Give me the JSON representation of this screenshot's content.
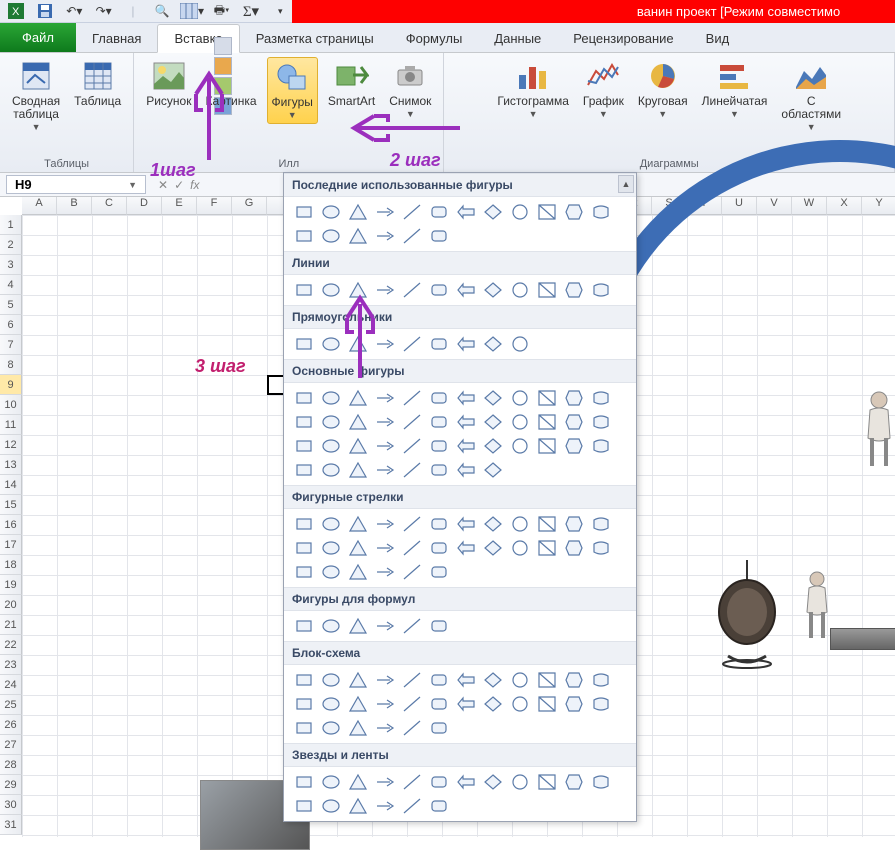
{
  "titlebar": {
    "title": "ванин проект  [Режим совместимо"
  },
  "qat": [
    {
      "name": "save-icon"
    },
    {
      "name": "undo-icon"
    },
    {
      "name": "redo-icon"
    },
    {
      "name": "preview-icon"
    },
    {
      "name": "pivot-icon"
    },
    {
      "name": "print-icon"
    },
    {
      "name": "sum-icon"
    }
  ],
  "tabs": {
    "file": "Файл",
    "home": "Главная",
    "insert": "Вставка",
    "layout": "Разметка страницы",
    "formulas": "Формулы",
    "data": "Данные",
    "review": "Рецензирование",
    "view": "Вид"
  },
  "ribbon": {
    "tables": {
      "group": "Таблицы",
      "pivot": "Сводная\nтаблица",
      "table": "Таблица"
    },
    "illustr": {
      "group": "Илл",
      "picture": "Рисунок",
      "clipart": "Картинка",
      "shapes": "Фигуры",
      "smartart": "SmartArt",
      "screenshot": "Снимок"
    },
    "charts": {
      "group": "Диаграммы",
      "column": "Гистограмма",
      "line": "График",
      "pie": "Круговая",
      "bar": "Линейчатая",
      "area": "С\nобластями"
    }
  },
  "namebox": "H9",
  "columns": [
    "A",
    "B",
    "C",
    "D",
    "E",
    "F",
    "G",
    "",
    "",
    "",
    "",
    "",
    "",
    "",
    "",
    "",
    "",
    "R",
    "S",
    "T",
    "U",
    "V",
    "W",
    "X",
    "Y"
  ],
  "rows": [
    "1",
    "2",
    "3",
    "4",
    "5",
    "6",
    "7",
    "8",
    "9",
    "10",
    "11",
    "12",
    "13",
    "14",
    "15",
    "16",
    "17",
    "18",
    "19",
    "20",
    "21",
    "22",
    "23",
    "24",
    "25",
    "26",
    "27",
    "28",
    "29",
    "30",
    "31"
  ],
  "selected_row": "9",
  "shapes_panel": {
    "cats": [
      {
        "label": "Последние использованные фигуры",
        "count": 18
      },
      {
        "label": "Линии",
        "count": 12
      },
      {
        "label": "Прямоугольники",
        "count": 9
      },
      {
        "label": "Основные фигуры",
        "count": 44
      },
      {
        "label": "Фигурные стрелки",
        "count": 30
      },
      {
        "label": "Фигуры для формул",
        "count": 6
      },
      {
        "label": "Блок-схема",
        "count": 30
      },
      {
        "label": "Звезды и ленты",
        "count": 18
      }
    ]
  },
  "annotations": {
    "step1": "1шаг",
    "step2": "2 шаг",
    "step3": "3 шаг"
  }
}
